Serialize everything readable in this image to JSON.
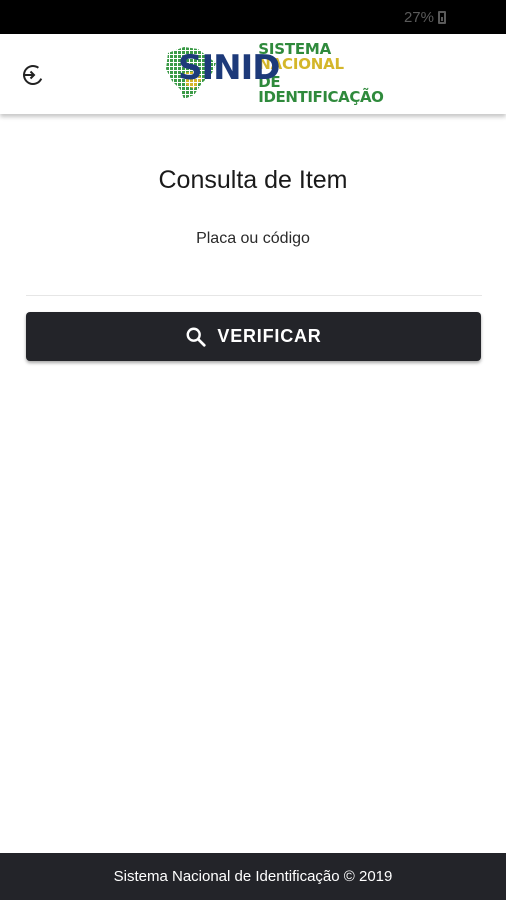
{
  "status_bar": {
    "battery_text": "27%",
    "icon": "battery-icon"
  },
  "header": {
    "logout_icon": "logout-icon",
    "logo": {
      "mark": "SINID",
      "line1a": "SISTEMA",
      "line1b": "NACIONAL",
      "line2": "DE IDENTIFICAÇÃO"
    }
  },
  "main": {
    "title": "Consulta de Item",
    "field_label": "Placa ou código",
    "input_value": "",
    "verify_button": {
      "label": "VERIFICAR",
      "icon": "search-icon"
    }
  },
  "footer": {
    "text": "Sistema Nacional de Identificação © 2019"
  },
  "colors": {
    "primary_dark": "#232429",
    "logo_blue": "#1d3a7a",
    "logo_green": "#2f8a3c",
    "logo_yellow": "#d4b62a"
  }
}
